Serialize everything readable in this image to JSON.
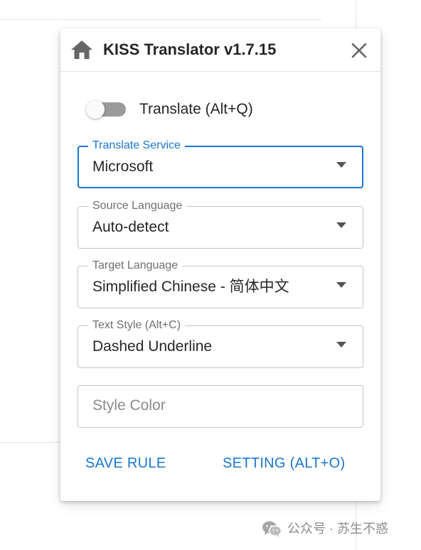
{
  "header": {
    "title": "KISS Translator v1.7.15"
  },
  "translate_toggle": {
    "label": "Translate (Alt+Q)",
    "on": false
  },
  "fields": {
    "translate_service": {
      "label": "Translate Service",
      "value": "Microsoft"
    },
    "source_language": {
      "label": "Source Language",
      "value": "Auto-detect"
    },
    "target_language": {
      "label": "Target Language",
      "value": "Simplified Chinese - 简体中文"
    },
    "text_style": {
      "label": "Text Style (Alt+C)",
      "value": "Dashed Underline"
    },
    "style_color": {
      "placeholder": "Style Color",
      "value": ""
    }
  },
  "actions": {
    "save_rule": "SAVE RULE",
    "setting": "SETTING (ALT+O)"
  },
  "watermark": {
    "text": "公众号 · 苏生不惑"
  },
  "colors": {
    "accent": "#1976d2",
    "text": "#262626",
    "label": "#6f6f6f",
    "border": "#c4c4c4",
    "icon": "#666666"
  },
  "icons": {
    "home": "home-icon",
    "close": "close-icon",
    "dropdown": "arrow-drop-down-icon",
    "wechat": "wechat-icon"
  }
}
